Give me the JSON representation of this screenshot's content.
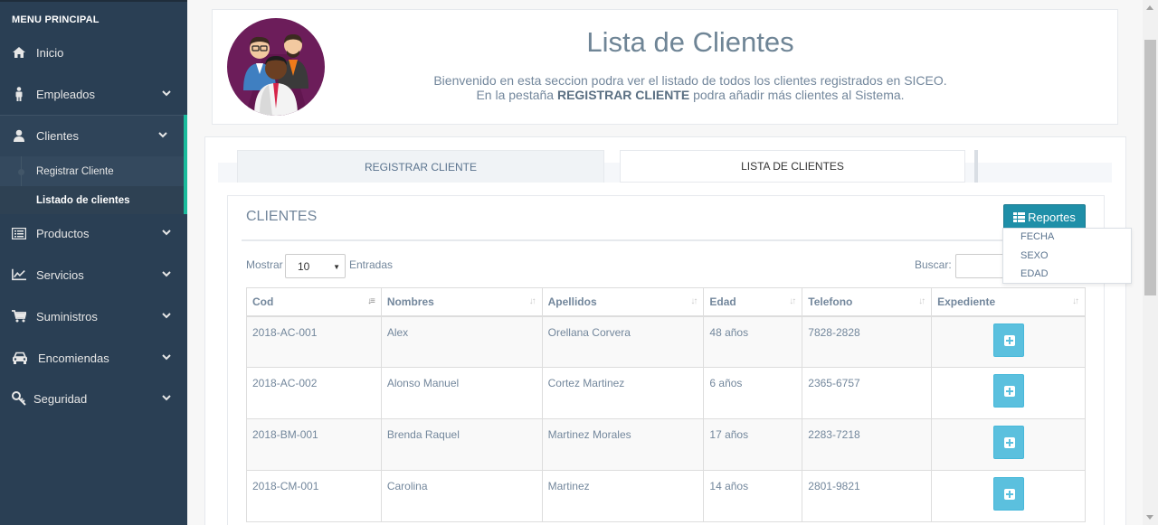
{
  "sidebar": {
    "menu_title": "MENU PRINCIPAL",
    "items": [
      {
        "label": "Inicio",
        "icon": "home-icon"
      },
      {
        "label": "Empleados",
        "icon": "user-male-icon"
      },
      {
        "label": "Clientes",
        "icon": "user-icon"
      },
      {
        "label": "Productos",
        "icon": "list-alt-icon"
      },
      {
        "label": "Servicios",
        "icon": "line-chart-icon"
      },
      {
        "label": "Suministros",
        "icon": "shopping-cart-icon"
      },
      {
        "label": "Encomiendas",
        "icon": "car-icon"
      },
      {
        "label": "Seguridad",
        "icon": "key-icon"
      }
    ],
    "clientes_submenu": [
      {
        "label": "Registrar Cliente"
      },
      {
        "label": "Listado de clientes"
      }
    ]
  },
  "header": {
    "title": "Lista de Clientes",
    "line1": "Bienvenido en esta seccion podra ver el listado de todos los clientes registrados en SICEO.",
    "line2_before": "En la pestaña ",
    "line2_bold": "REGISTRAR CLIENTE",
    "line2_after": " podra añadir más clientes al Sistema."
  },
  "tabs": [
    {
      "label": "REGISTRAR CLIENTE"
    },
    {
      "label": "LISTA DE CLIENTES"
    }
  ],
  "clients_panel": {
    "title": "CLIENTES",
    "reportes_label": "Reportes",
    "reportes_menu": [
      "FECHA",
      "SEXO",
      "EDAD"
    ],
    "show_label": "Mostrar",
    "show_value": "10",
    "entries_label": "Entradas",
    "search_label": "Buscar:",
    "search_value": ""
  },
  "table": {
    "columns": [
      "Cod",
      "Nombres",
      "Apellidos",
      "Edad",
      "Telefono",
      "Expediente"
    ],
    "rows": [
      {
        "cod": "2018-AC-001",
        "nombres": "Alex",
        "apellidos": "Orellana Corvera",
        "edad": "48 años",
        "telefono": "7828-2828"
      },
      {
        "cod": "2018-AC-002",
        "nombres": "Alonso Manuel",
        "apellidos": "Cortez Martinez",
        "edad": "6 años",
        "telefono": "2365-6757"
      },
      {
        "cod": "2018-BM-001",
        "nombres": "Brenda Raquel",
        "apellidos": "Martinez Morales",
        "edad": "17 años",
        "telefono": "2283-7218"
      },
      {
        "cod": "2018-CM-001",
        "nombres": "Carolina",
        "apellidos": "Martinez",
        "edad": "14 años",
        "telefono": "2801-9821"
      }
    ]
  },
  "colors": {
    "sidebar_bg": "#2a3f54",
    "active_accent": "#1abb9c",
    "reportes_btn": "#1f8fa8",
    "expediente_btn": "#5bc0de"
  }
}
